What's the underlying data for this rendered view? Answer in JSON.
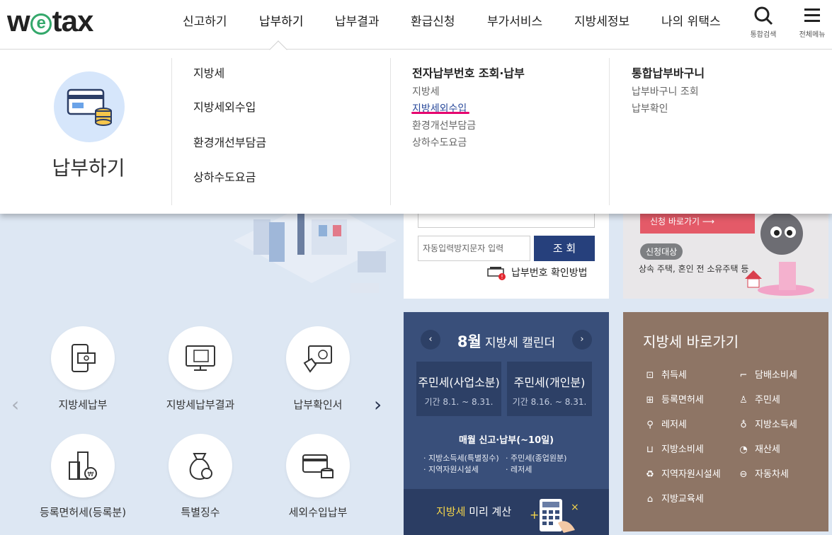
{
  "header": {
    "logo": {
      "prefix": "w",
      "e": "e",
      "suffix": "tax"
    },
    "nav": [
      "신고하기",
      "납부하기",
      "납부결과",
      "환급신청",
      "부가서비스",
      "지방세정보",
      "나의 위택스"
    ],
    "active_nav": "납부하기",
    "search_label": "통합검색",
    "menu_label": "전체메뉴"
  },
  "mega": {
    "title": "납부하기",
    "col1": [
      "지방세",
      "지방세외수입",
      "환경개선부담금",
      "상하수도요금"
    ],
    "col2": {
      "heading": "전자납부번호 조회·납부",
      "items": [
        "지방세",
        "지방세외수입",
        "환경개선부담금",
        "상하수도요금"
      ],
      "active": "지방세외수입"
    },
    "col3": {
      "heading": "통합납부바구니",
      "items": [
        "납부바구니 조회",
        "납부확인"
      ]
    }
  },
  "form": {
    "captcha_placeholder": "자동입력방지문자 입력",
    "view_button": "조 회",
    "help_link": "납부번호 확인방법"
  },
  "promo": {
    "apply_button": "신청 바로가기",
    "tag": "신청대상",
    "desc": "상속 주택, 혼인 전 소유주택 등"
  },
  "services": [
    "지방세납부",
    "지방세납부결과",
    "납부확인서",
    "등록면허세(등록분)",
    "특별징수",
    "세외수입납부"
  ],
  "calendar": {
    "month": "8월",
    "title": "지방세 캘린더",
    "boxes": [
      {
        "title": "주민세(사업소분)",
        "period": "기간 8.1. ~ 8.31."
      },
      {
        "title": "주민세(개인분)",
        "period": "기간 8.16. ~ 8.31."
      }
    ],
    "monthly_title": "매월 신고·납부(~10일)",
    "monthly_items": [
      "지방소득세(특별징수)",
      "주민세(종업원분)",
      "지역자원시설세",
      "레저세"
    ],
    "footer_highlight": "지방세",
    "footer_text": "미리 계산"
  },
  "shortcuts": {
    "title": "지방세 바로가기",
    "items": [
      "취득세",
      "담배소비세",
      "등록면허세",
      "주민세",
      "레저세",
      "지방소득세",
      "지방소비세",
      "재산세",
      "지역자원시설세",
      "자동차세",
      "지방교육세"
    ]
  },
  "colors": {
    "accent": "#26407c",
    "underline": "#e6006e",
    "calendar_bg": "#394f7a",
    "shortcut_bg": "#8e7565",
    "logo_green": "#34a86b"
  }
}
